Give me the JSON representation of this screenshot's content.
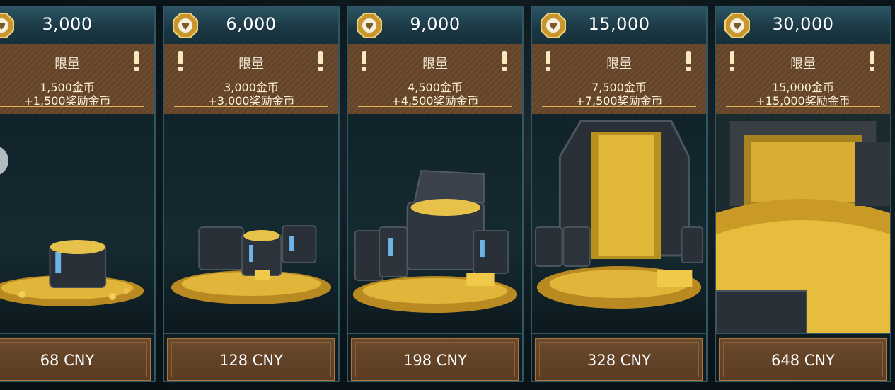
{
  "colors": {
    "accent_gold": "#e4b054",
    "panel_teal": "#1b3742",
    "offer_brown": "#6d4c2e",
    "button_brown": "#5a3c22"
  },
  "icons": {
    "coin": "gold-coin-emblem-icon",
    "warning": "exclamation-icon"
  },
  "packs": [
    {
      "amount": "3,000",
      "limit_label": "限量",
      "line1": "1,500金币",
      "line2": "+1,500奖励金币",
      "price": "68 CNY"
    },
    {
      "amount": "6,000",
      "limit_label": "限量",
      "line1": "3,000金币",
      "line2": "+3,000奖励金币",
      "price": "128 CNY"
    },
    {
      "amount": "9,000",
      "limit_label": "限量",
      "line1": "4,500金币",
      "line2": "+4,500奖励金币",
      "price": "198 CNY"
    },
    {
      "amount": "15,000",
      "limit_label": "限量",
      "line1": "7,500金币",
      "line2": "+7,500奖励金币",
      "price": "328 CNY"
    },
    {
      "amount": "30,000",
      "limit_label": "限量",
      "line1": "15,000金币",
      "line2": "+15,000奖励金币",
      "price": "648 CNY"
    }
  ]
}
